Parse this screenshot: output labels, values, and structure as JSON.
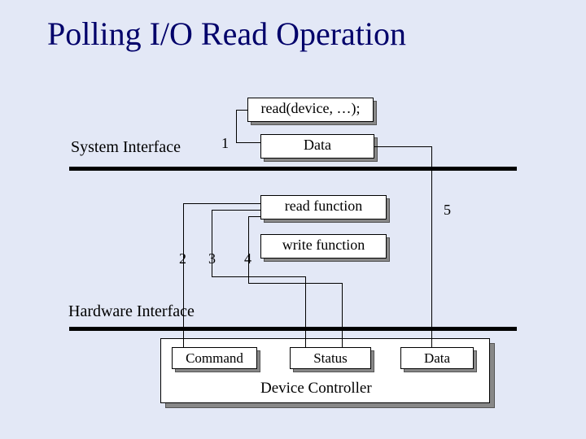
{
  "title": "Polling I/O Read Operation",
  "labels": {
    "system_interface": "System Interface",
    "hardware_interface": "Hardware Interface",
    "device_controller": "Device Controller"
  },
  "boxes": {
    "read_call": "read(device, …);",
    "data_top": "Data",
    "read_function": "read function",
    "write_function": "write function",
    "command": "Command",
    "status": "Status",
    "data_bottom": "Data"
  },
  "numbers": {
    "n1": "1",
    "n2": "2",
    "n3": "3",
    "n4": "4",
    "n5": "5"
  }
}
